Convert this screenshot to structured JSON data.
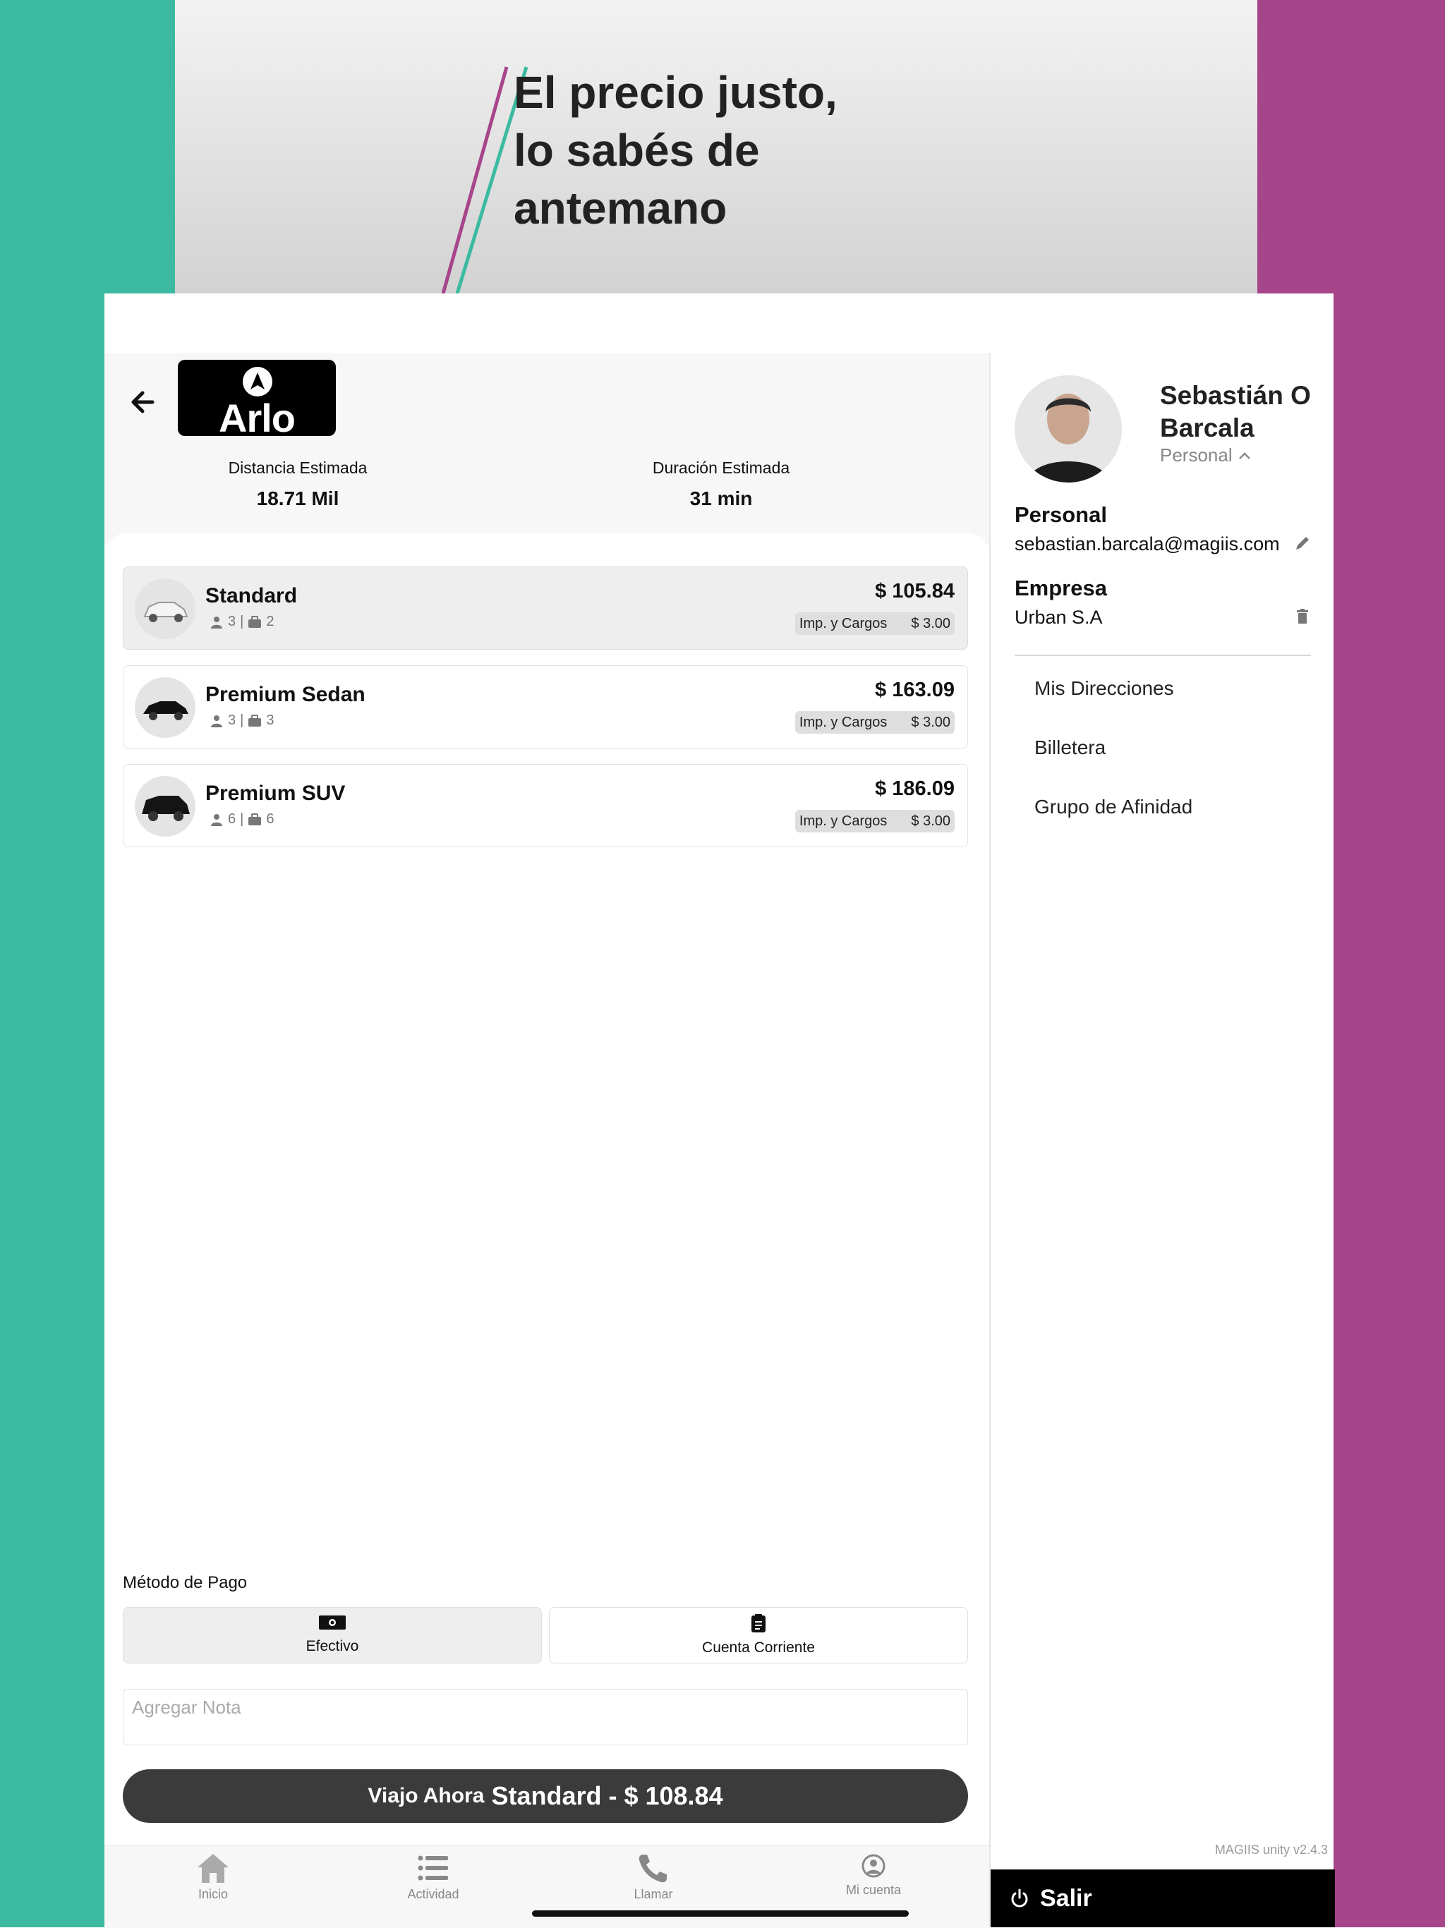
{
  "banner": {
    "slogan": "El precio justo,\nlo sabés de\nantemano"
  },
  "header": {
    "logo_text": "Arlo"
  },
  "trip": {
    "distance_label": "Distancia Estimada",
    "distance_value": "18.71 Mil",
    "duration_label": "Duración Estimada",
    "duration_value": "31 min"
  },
  "vehicles": [
    {
      "name": "Standard",
      "passengers": "3",
      "bags": "2",
      "price": "$ 105.84",
      "fees_label": "Imp. y Cargos",
      "fees_value": "$ 3.00"
    },
    {
      "name": "Premium Sedan",
      "passengers": "3",
      "bags": "3",
      "price": "$ 163.09",
      "fees_label": "Imp. y Cargos",
      "fees_value": "$ 3.00"
    },
    {
      "name": "Premium SUV",
      "passengers": "6",
      "bags": "6",
      "price": "$ 186.09",
      "fees_label": "Imp. y Cargos",
      "fees_value": "$ 3.00"
    }
  ],
  "payment": {
    "label": "Método de Pago",
    "options": [
      {
        "label": "Efectivo"
      },
      {
        "label": "Cuenta Corriente"
      }
    ]
  },
  "note": {
    "placeholder": "Agregar Nota"
  },
  "cta": {
    "prefix": "Viajo Ahora",
    "detail": "Standard - $ 108.84"
  },
  "nav": [
    {
      "label": "Inicio"
    },
    {
      "label": "Actividad"
    },
    {
      "label": "Llamar"
    },
    {
      "label": "Mi cuenta"
    }
  ],
  "profile": {
    "name": "Sebastián O Barcala",
    "type": "Personal",
    "personal_title": "Personal",
    "personal_email": "sebastian.barcala@magiis.com",
    "company_title": "Empresa",
    "company_name": "Urban S.A"
  },
  "menu": [
    {
      "label": "Mis Direcciones"
    },
    {
      "label": "Billetera"
    },
    {
      "label": "Grupo de Afinidad"
    }
  ],
  "version": "MAGIIS unity v2.4.3",
  "logout_label": "Salir",
  "colors": {
    "teal": "#3bbaa1",
    "magenta": "#a7458b",
    "dark": "#3b3b3b"
  }
}
